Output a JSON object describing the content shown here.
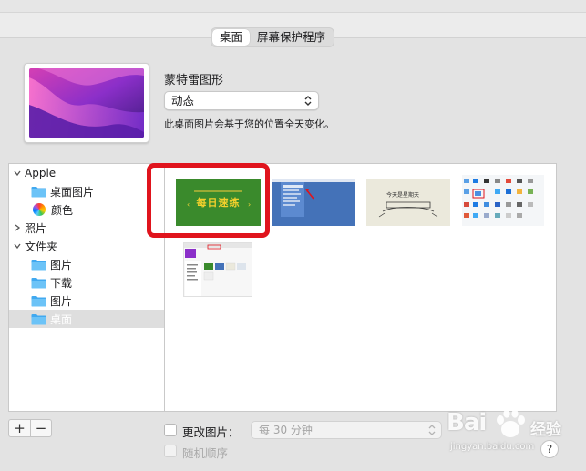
{
  "tabs": [
    {
      "label": "桌面",
      "active": true
    },
    {
      "label": "屏幕保护程序",
      "active": false
    }
  ],
  "wallpaper": {
    "name": "蒙特雷图形",
    "mode": "动态",
    "description": "此桌面图片会基于您的位置全天变化。"
  },
  "sidebar": {
    "items": [
      {
        "label": "Apple",
        "type": "group",
        "expanded": true
      },
      {
        "label": "桌面图片",
        "type": "folder"
      },
      {
        "label": "颜色",
        "type": "colors"
      },
      {
        "label": "照片",
        "type": "group",
        "expanded": false
      },
      {
        "label": "文件夹",
        "type": "group",
        "expanded": true
      },
      {
        "label": "图片",
        "type": "folder"
      },
      {
        "label": "下载",
        "type": "folder"
      },
      {
        "label": "图片",
        "type": "folder"
      },
      {
        "label": "桌面",
        "type": "folder",
        "selected": true
      }
    ]
  },
  "thumbnails": {
    "thumb1_text": "每日速练",
    "thumb3_text": "今天是星期天"
  },
  "controls": {
    "add": "+",
    "remove": "−",
    "change_picture_label": "更改图片：",
    "interval": "每 30 分钟",
    "random_order_label": "随机顺序",
    "help": "?"
  },
  "watermark": {
    "brand": "Bai",
    "sub": "经验",
    "url": "jingyan.baidu.com"
  },
  "colors": {
    "accent_red": "#e0141d",
    "thumb_green": "#3a8a2c",
    "thumb_blue": "#4472b8",
    "folder_blue": "#41a9f0"
  }
}
